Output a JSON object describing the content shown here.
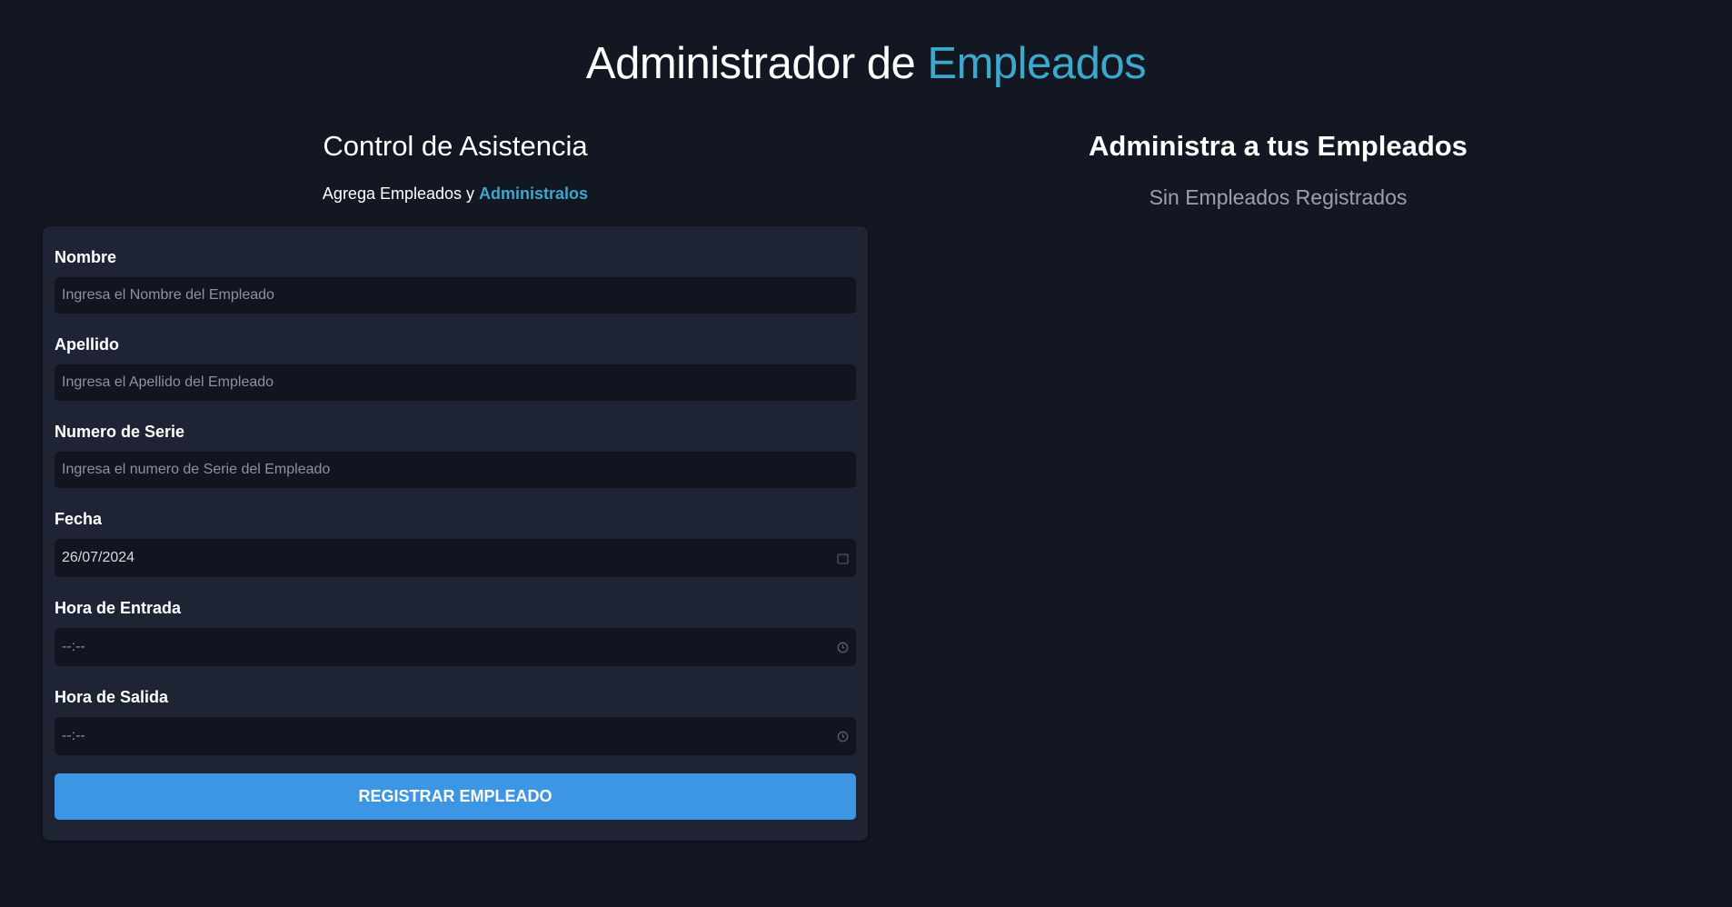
{
  "header": {
    "title_part1": "Administrador de ",
    "title_part2": "Empleados"
  },
  "form_section": {
    "title": "Control de Asistencia",
    "subtitle_part1": "Agrega Empleados y ",
    "subtitle_part2": "Administralos"
  },
  "form": {
    "fields": [
      {
        "label": "Nombre",
        "placeholder": "Ingresa el Nombre del Empleado",
        "value": ""
      },
      {
        "label": "Apellido",
        "placeholder": "Ingresa el Apellido del Empleado",
        "value": ""
      },
      {
        "label": "Numero de Serie",
        "placeholder": "Ingresa el numero de Serie del Empleado",
        "value": ""
      },
      {
        "label": "Fecha",
        "value": "26/07/2024",
        "icon": "calendar-icon"
      },
      {
        "label": "Hora de Entrada",
        "value": "--:--",
        "icon": "clock-icon"
      },
      {
        "label": "Hora de Salida",
        "value": "--:--",
        "icon": "clock-icon"
      }
    ],
    "submit_label": "REGISTRAR EMPLEADO"
  },
  "list_section": {
    "title": "Administra a tus Empleados",
    "empty_message": "Sin Empleados Registrados"
  },
  "colors": {
    "background": "#131722",
    "card": "#1f2435",
    "input": "#121520",
    "accent": "#3ba8cc",
    "button": "#3c96e3"
  }
}
